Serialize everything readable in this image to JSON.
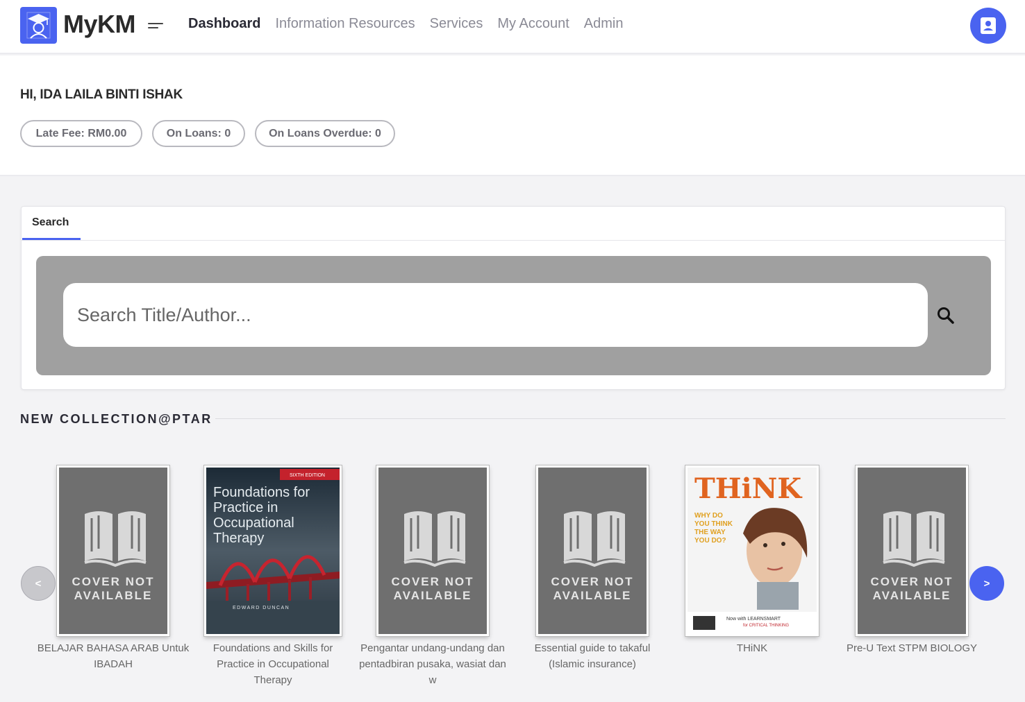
{
  "app": {
    "brand": "MyKM",
    "logo_icon": "graduate-logo-icon",
    "accent": "#4a63f0"
  },
  "nav": {
    "items": [
      {
        "label": "Dashboard",
        "active": true
      },
      {
        "label": "Information Resources",
        "active": false
      },
      {
        "label": "Services",
        "active": false
      },
      {
        "label": "My Account",
        "active": false
      },
      {
        "label": "Admin",
        "active": false
      }
    ],
    "menu_icon": "hamburger-icon",
    "profile_icon": "profile-card-icon"
  },
  "greeting": "HI, IDA LAILA BINTI ISHAK",
  "stats": {
    "late_fee": "Late Fee: RM0.00",
    "on_loans": "On Loans: 0",
    "overdue": "On Loans Overdue: 0"
  },
  "search": {
    "tab_label": "Search",
    "placeholder": "Search Title/Author...",
    "icon": "search-icon"
  },
  "collection": {
    "title": "NEW COLLECTION@PTAR",
    "prev_label": "<",
    "next_label": ">",
    "cover_na_line1": "COVER NOT",
    "cover_na_line2": "AVAILABLE",
    "books": [
      {
        "title": "BELAJAR BAHASA ARAB Untuk IBADAH",
        "cover": "not-available"
      },
      {
        "title": "Foundations and Skills for Practice in Occupational Therapy",
        "cover": "image",
        "cover_title": "Foundations for Practice in Occupational Therapy",
        "cover_edition": "SIXTH EDITION",
        "cover_author": "EDWARD DUNCAN"
      },
      {
        "title": "Pengantar undang-undang dan pentadbiran pusaka, wasiat dan w",
        "cover": "not-available"
      },
      {
        "title": "Essential guide to takaful (Islamic insurance)",
        "cover": "not-available"
      },
      {
        "title": "THiNK",
        "cover": "image",
        "cover_title": "THiNK",
        "cover_tagline": "WHY DO YOU THINK THE WAY YOU DO?",
        "cover_banner": "Now with LEARNSMART for CRITICAL THINKING"
      },
      {
        "title": "Pre-U Text STPM BIOLOGY",
        "cover": "not-available"
      }
    ]
  }
}
